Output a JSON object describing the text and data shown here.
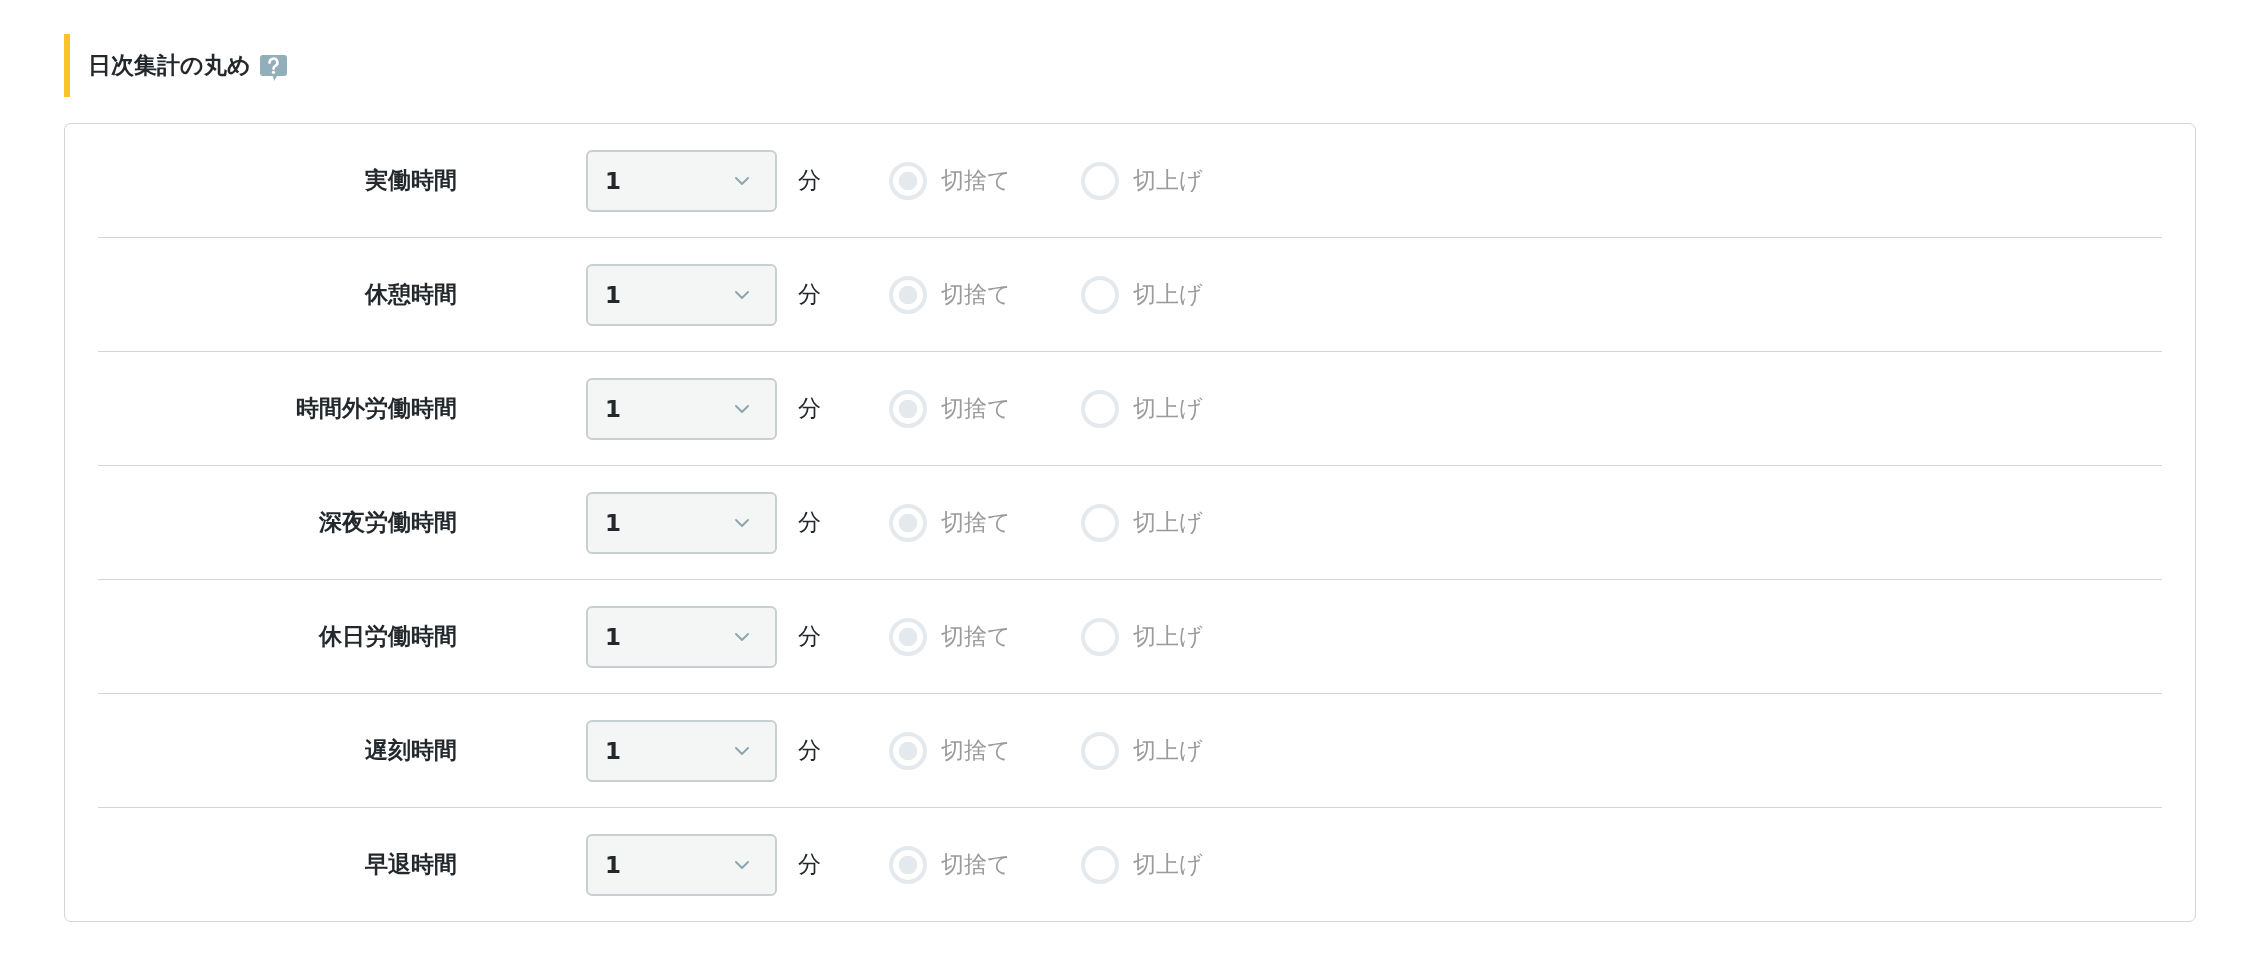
{
  "section": {
    "title": "日次集計の丸め"
  },
  "rows": [
    {
      "label": "実働時間",
      "value": "1",
      "unit": "分",
      "options": [
        {
          "label": "切捨て",
          "selected": true,
          "disabled": true
        },
        {
          "label": "切上げ",
          "selected": false,
          "disabled": true
        }
      ]
    },
    {
      "label": "休憩時間",
      "value": "1",
      "unit": "分",
      "options": [
        {
          "label": "切捨て",
          "selected": true,
          "disabled": true
        },
        {
          "label": "切上げ",
          "selected": false,
          "disabled": true
        }
      ]
    },
    {
      "label": "時間外労働時間",
      "value": "1",
      "unit": "分",
      "options": [
        {
          "label": "切捨て",
          "selected": true,
          "disabled": true
        },
        {
          "label": "切上げ",
          "selected": false,
          "disabled": true
        }
      ]
    },
    {
      "label": "深夜労働時間",
      "value": "1",
      "unit": "分",
      "options": [
        {
          "label": "切捨て",
          "selected": true,
          "disabled": true
        },
        {
          "label": "切上げ",
          "selected": false,
          "disabled": true
        }
      ]
    },
    {
      "label": "休日労働時間",
      "value": "1",
      "unit": "分",
      "options": [
        {
          "label": "切捨て",
          "selected": true,
          "disabled": true
        },
        {
          "label": "切上げ",
          "selected": false,
          "disabled": true
        }
      ]
    },
    {
      "label": "遅刻時間",
      "value": "1",
      "unit": "分",
      "options": [
        {
          "label": "切捨て",
          "selected": true,
          "disabled": true
        },
        {
          "label": "切上げ",
          "selected": false,
          "disabled": true
        }
      ]
    },
    {
      "label": "早退時間",
      "value": "1",
      "unit": "分",
      "options": [
        {
          "label": "切捨て",
          "selected": true,
          "disabled": true
        },
        {
          "label": "切上げ",
          "selected": false,
          "disabled": true
        }
      ]
    }
  ]
}
